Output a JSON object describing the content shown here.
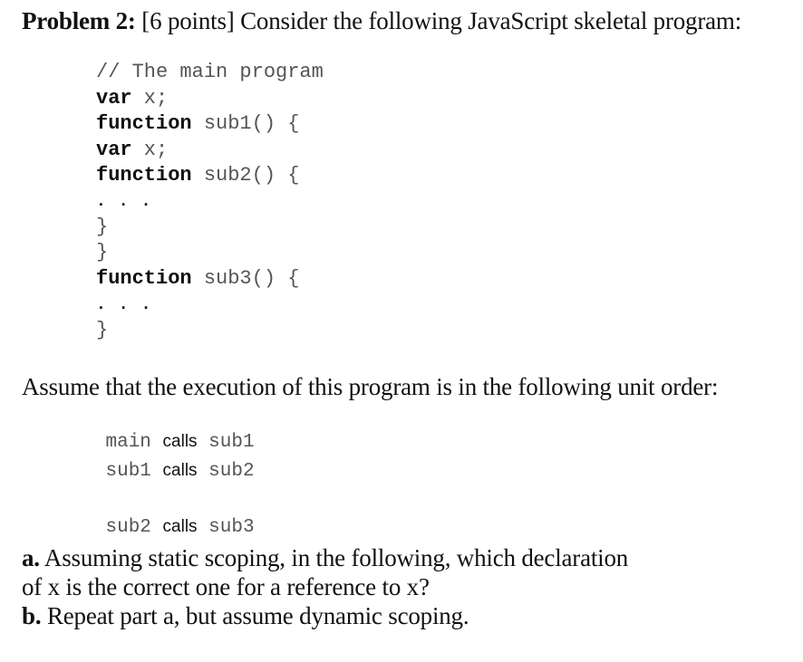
{
  "heading": {
    "label": "Problem 2:",
    "points": "[6 points]",
    "text": "Consider the following JavaScript skeletal program:"
  },
  "code": {
    "comment": "// The main program",
    "var_kw": "var",
    "var_x": " x;",
    "function_kw": "function",
    "sub1_sig": " sub1() {",
    "sub2_sig": " sub2() {",
    "sub3_sig": " sub3() {",
    "dots": "...",
    "close_brace": "}"
  },
  "assume": {
    "text": "Assume that the execution of this program is in the following unit order:"
  },
  "call_order": [
    {
      "caller": "main",
      "verb": "calls",
      "callee": "sub1"
    },
    {
      "caller": "sub1",
      "verb": "calls",
      "callee": "sub2"
    },
    {
      "caller": "sub2",
      "verb": "calls",
      "callee": "sub3"
    }
  ],
  "questions": {
    "a_label": "a.",
    "a_text_line1": "Assuming static scoping, in the following, which declaration",
    "a_text_line2": "of x is the correct one for a reference to x?",
    "b_label": "b.",
    "b_text": "Repeat part a, but assume dynamic scoping."
  }
}
